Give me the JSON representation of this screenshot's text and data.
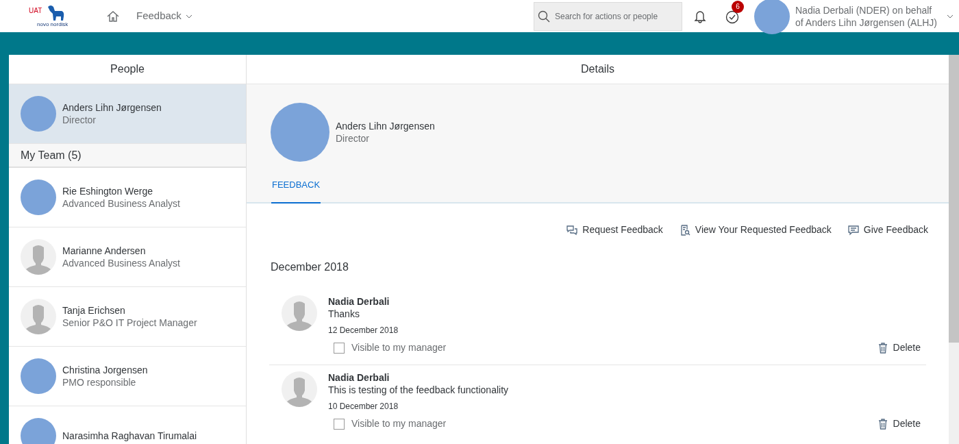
{
  "header": {
    "env_label": "UAT",
    "logo_text": "novo nordisk",
    "nav_title": "Feedback",
    "search": {
      "placeholder": "Search for actions or people"
    },
    "tasks_badge": "6",
    "user": {
      "line1": "Nadia Derbali (NDER) on behalf",
      "line2": "of Anders Lihn Jørgensen (ALHJ)",
      "kind": "photo"
    }
  },
  "people": {
    "title": "People",
    "current": {
      "name": "Anders Lihn Jørgensen",
      "role": "Director",
      "kind": "photo",
      "selected": true
    },
    "team_heading": "My Team (5)",
    "team": [
      {
        "name": "Rie Eshington Werge",
        "role": "Advanced Business Analyst",
        "kind": "photo",
        "selected": false
      },
      {
        "name": "Marianne Andersen",
        "role": "Advanced Business Analyst",
        "kind": "placeholder",
        "selected": false
      },
      {
        "name": "Tanja Erichsen",
        "role": "Senior P&O IT Project Manager",
        "kind": "placeholder",
        "selected": false
      },
      {
        "name": "Christina Jorgensen",
        "role": "PMO responsible",
        "kind": "photo",
        "selected": false
      },
      {
        "name": "Narasimha Raghavan Tirumalai",
        "kind": "photo",
        "selected": false
      }
    ]
  },
  "details": {
    "title": "Details",
    "person": {
      "name": "Anders Lihn Jørgensen",
      "role": "Director",
      "kind": "photo"
    },
    "tabs": [
      {
        "label": "FEEDBACK",
        "selected": true
      }
    ],
    "actions": [
      {
        "label": "Request Feedback",
        "kind": "request"
      },
      {
        "label": "View Your Requested Feedback",
        "kind": "view"
      },
      {
        "label": "Give Feedback",
        "kind": "give"
      }
    ],
    "month": "December 2018",
    "entries": [
      {
        "author": "Nadia Derbali",
        "text": "Thanks",
        "date": "12 December 2018",
        "visible_label": "Visible to my manager",
        "checked": false,
        "delete_label": "Delete"
      },
      {
        "author": "Nadia Derbali",
        "text": "This is testing of the feedback functionality",
        "date": "10 December 2018",
        "visible_label": "Visible to my manager",
        "checked": false,
        "delete_label": "Delete"
      }
    ]
  }
}
